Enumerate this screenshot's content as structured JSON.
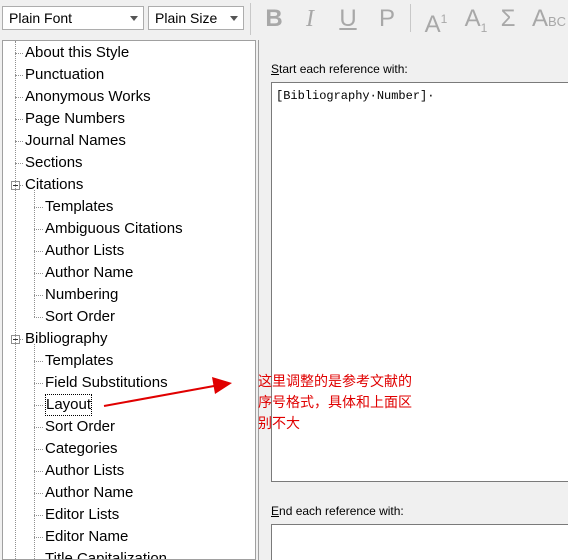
{
  "toolbar": {
    "font": "Plain Font",
    "size": "Plain Size",
    "bold": "B",
    "italic": "I",
    "underline": "U",
    "plain": "P",
    "superscript_base": "A",
    "superscript_mark": "1",
    "subscript_base": "A",
    "subscript_mark": "1",
    "symbol": "Σ",
    "smallcaps_big": "A",
    "smallcaps_small": "BC"
  },
  "tree": [
    {
      "label": "About this Style",
      "level": 0
    },
    {
      "label": "Punctuation",
      "level": 0
    },
    {
      "label": "Anonymous Works",
      "level": 0
    },
    {
      "label": "Page Numbers",
      "level": 0
    },
    {
      "label": "Journal Names",
      "level": 0
    },
    {
      "label": "Sections",
      "level": 0
    },
    {
      "label": "Citations",
      "level": 0,
      "expanded": true
    },
    {
      "label": "Templates",
      "level": 1
    },
    {
      "label": "Ambiguous Citations",
      "level": 1
    },
    {
      "label": "Author Lists",
      "level": 1
    },
    {
      "label": "Author Name",
      "level": 1
    },
    {
      "label": "Numbering",
      "level": 1
    },
    {
      "label": "Sort Order",
      "level": 1
    },
    {
      "label": "Bibliography",
      "level": 0,
      "expanded": true
    },
    {
      "label": "Templates",
      "level": 1
    },
    {
      "label": "Field Substitutions",
      "level": 1
    },
    {
      "label": "Layout",
      "level": 1,
      "selected": true
    },
    {
      "label": "Sort Order",
      "level": 1
    },
    {
      "label": "Categories",
      "level": 1
    },
    {
      "label": "Author Lists",
      "level": 1
    },
    {
      "label": "Author Name",
      "level": 1
    },
    {
      "label": "Editor Lists",
      "level": 1
    },
    {
      "label": "Editor Name",
      "level": 1
    },
    {
      "label": "Title Capitalization",
      "level": 1
    }
  ],
  "right": {
    "start_label_first": "S",
    "start_label_rest": "tart each reference with:",
    "start_value": "[Bibliography·Number]·",
    "end_label_first": "E",
    "end_label_rest": "nd each reference with:",
    "end_value": ""
  },
  "annotation": {
    "line1": "这里调整的是参考文献的",
    "line2": "序号格式，具体和上面区",
    "line3": "别不大",
    "color": "#e00000"
  }
}
